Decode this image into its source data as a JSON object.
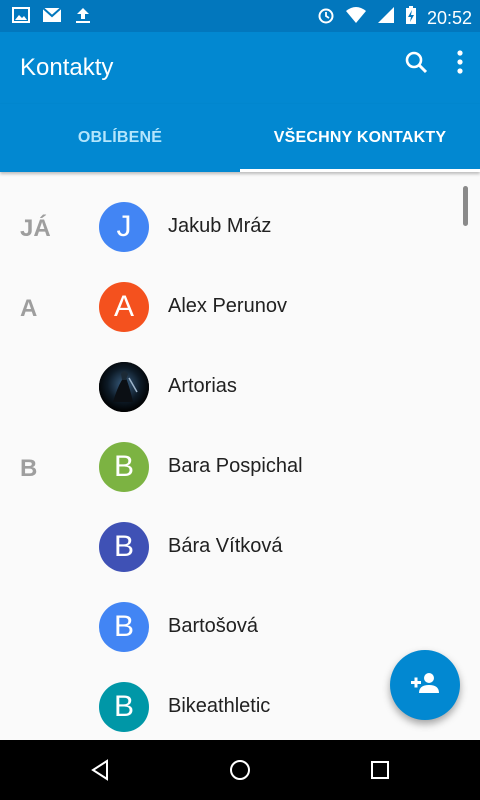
{
  "status_bar": {
    "time": "20:52",
    "left_icons": [
      "image-icon",
      "gmail-icon",
      "upload-icon"
    ],
    "right_icons": [
      "alarm-icon",
      "wifi-icon",
      "signal-icon",
      "battery-charging-icon"
    ]
  },
  "app_bar": {
    "title": "Kontakty",
    "actions": [
      "search-icon",
      "more-vert-icon"
    ],
    "color": "#0288d1"
  },
  "tabs": [
    {
      "label": "OBLÍBENÉ",
      "active": false
    },
    {
      "label": "VŠECHNY KONTAKTY",
      "active": true
    }
  ],
  "contacts": [
    {
      "section": "JÁ",
      "initial": "J",
      "name": "Jakub Mráz",
      "avatar_color": "#4285f4"
    },
    {
      "section": "A",
      "initial": "A",
      "name": "Alex Perunov",
      "avatar_color": "#f4511e"
    },
    {
      "section": "",
      "initial": "",
      "name": "Artorias",
      "avatar_color": "#000000",
      "photo": true
    },
    {
      "section": "B",
      "initial": "B",
      "name": "Bara Pospichal",
      "avatar_color": "#7cb342"
    },
    {
      "section": "",
      "initial": "B",
      "name": "Bára Vítková",
      "avatar_color": "#3f51b5"
    },
    {
      "section": "",
      "initial": "B",
      "name": "Bartošová",
      "avatar_color": "#4285f4"
    },
    {
      "section": "",
      "initial": "B",
      "name": "Bikeathletic",
      "avatar_color": "#0097a7"
    }
  ],
  "fab": {
    "icon": "add-person-icon"
  },
  "nav_bar": {
    "buttons": [
      "back-icon",
      "home-icon",
      "recents-icon"
    ]
  }
}
